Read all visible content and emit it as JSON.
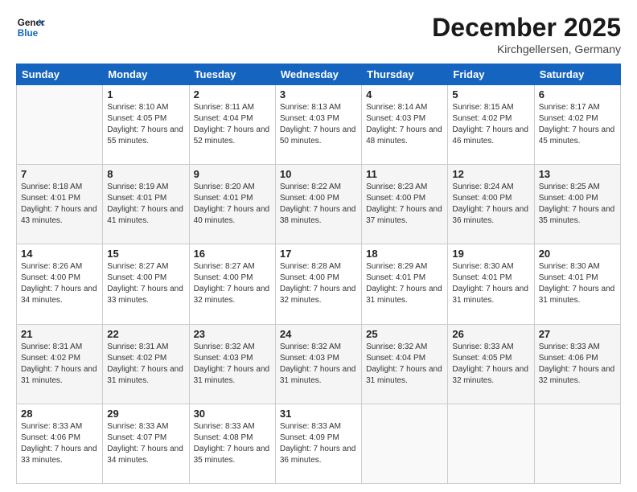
{
  "logo": {
    "line1": "General",
    "line2": "Blue"
  },
  "title": "December 2025",
  "location": "Kirchgellersen, Germany",
  "days_of_week": [
    "Sunday",
    "Monday",
    "Tuesday",
    "Wednesday",
    "Thursday",
    "Friday",
    "Saturday"
  ],
  "weeks": [
    [
      {
        "day": "",
        "info": ""
      },
      {
        "day": "1",
        "info": "Sunrise: 8:10 AM\nSunset: 4:05 PM\nDaylight: 7 hours\nand 55 minutes."
      },
      {
        "day": "2",
        "info": "Sunrise: 8:11 AM\nSunset: 4:04 PM\nDaylight: 7 hours\nand 52 minutes."
      },
      {
        "day": "3",
        "info": "Sunrise: 8:13 AM\nSunset: 4:03 PM\nDaylight: 7 hours\nand 50 minutes."
      },
      {
        "day": "4",
        "info": "Sunrise: 8:14 AM\nSunset: 4:03 PM\nDaylight: 7 hours\nand 48 minutes."
      },
      {
        "day": "5",
        "info": "Sunrise: 8:15 AM\nSunset: 4:02 PM\nDaylight: 7 hours\nand 46 minutes."
      },
      {
        "day": "6",
        "info": "Sunrise: 8:17 AM\nSunset: 4:02 PM\nDaylight: 7 hours\nand 45 minutes."
      }
    ],
    [
      {
        "day": "7",
        "info": "Sunrise: 8:18 AM\nSunset: 4:01 PM\nDaylight: 7 hours\nand 43 minutes."
      },
      {
        "day": "8",
        "info": "Sunrise: 8:19 AM\nSunset: 4:01 PM\nDaylight: 7 hours\nand 41 minutes."
      },
      {
        "day": "9",
        "info": "Sunrise: 8:20 AM\nSunset: 4:01 PM\nDaylight: 7 hours\nand 40 minutes."
      },
      {
        "day": "10",
        "info": "Sunrise: 8:22 AM\nSunset: 4:00 PM\nDaylight: 7 hours\nand 38 minutes."
      },
      {
        "day": "11",
        "info": "Sunrise: 8:23 AM\nSunset: 4:00 PM\nDaylight: 7 hours\nand 37 minutes."
      },
      {
        "day": "12",
        "info": "Sunrise: 8:24 AM\nSunset: 4:00 PM\nDaylight: 7 hours\nand 36 minutes."
      },
      {
        "day": "13",
        "info": "Sunrise: 8:25 AM\nSunset: 4:00 PM\nDaylight: 7 hours\nand 35 minutes."
      }
    ],
    [
      {
        "day": "14",
        "info": "Sunrise: 8:26 AM\nSunset: 4:00 PM\nDaylight: 7 hours\nand 34 minutes."
      },
      {
        "day": "15",
        "info": "Sunrise: 8:27 AM\nSunset: 4:00 PM\nDaylight: 7 hours\nand 33 minutes."
      },
      {
        "day": "16",
        "info": "Sunrise: 8:27 AM\nSunset: 4:00 PM\nDaylight: 7 hours\nand 32 minutes."
      },
      {
        "day": "17",
        "info": "Sunrise: 8:28 AM\nSunset: 4:00 PM\nDaylight: 7 hours\nand 32 minutes."
      },
      {
        "day": "18",
        "info": "Sunrise: 8:29 AM\nSunset: 4:01 PM\nDaylight: 7 hours\nand 31 minutes."
      },
      {
        "day": "19",
        "info": "Sunrise: 8:30 AM\nSunset: 4:01 PM\nDaylight: 7 hours\nand 31 minutes."
      },
      {
        "day": "20",
        "info": "Sunrise: 8:30 AM\nSunset: 4:01 PM\nDaylight: 7 hours\nand 31 minutes."
      }
    ],
    [
      {
        "day": "21",
        "info": "Sunrise: 8:31 AM\nSunset: 4:02 PM\nDaylight: 7 hours\nand 31 minutes."
      },
      {
        "day": "22",
        "info": "Sunrise: 8:31 AM\nSunset: 4:02 PM\nDaylight: 7 hours\nand 31 minutes."
      },
      {
        "day": "23",
        "info": "Sunrise: 8:32 AM\nSunset: 4:03 PM\nDaylight: 7 hours\nand 31 minutes."
      },
      {
        "day": "24",
        "info": "Sunrise: 8:32 AM\nSunset: 4:03 PM\nDaylight: 7 hours\nand 31 minutes."
      },
      {
        "day": "25",
        "info": "Sunrise: 8:32 AM\nSunset: 4:04 PM\nDaylight: 7 hours\nand 31 minutes."
      },
      {
        "day": "26",
        "info": "Sunrise: 8:33 AM\nSunset: 4:05 PM\nDaylight: 7 hours\nand 32 minutes."
      },
      {
        "day": "27",
        "info": "Sunrise: 8:33 AM\nSunset: 4:06 PM\nDaylight: 7 hours\nand 32 minutes."
      }
    ],
    [
      {
        "day": "28",
        "info": "Sunrise: 8:33 AM\nSunset: 4:06 PM\nDaylight: 7 hours\nand 33 minutes."
      },
      {
        "day": "29",
        "info": "Sunrise: 8:33 AM\nSunset: 4:07 PM\nDaylight: 7 hours\nand 34 minutes."
      },
      {
        "day": "30",
        "info": "Sunrise: 8:33 AM\nSunset: 4:08 PM\nDaylight: 7 hours\nand 35 minutes."
      },
      {
        "day": "31",
        "info": "Sunrise: 8:33 AM\nSunset: 4:09 PM\nDaylight: 7 hours\nand 36 minutes."
      },
      {
        "day": "",
        "info": ""
      },
      {
        "day": "",
        "info": ""
      },
      {
        "day": "",
        "info": ""
      }
    ]
  ]
}
